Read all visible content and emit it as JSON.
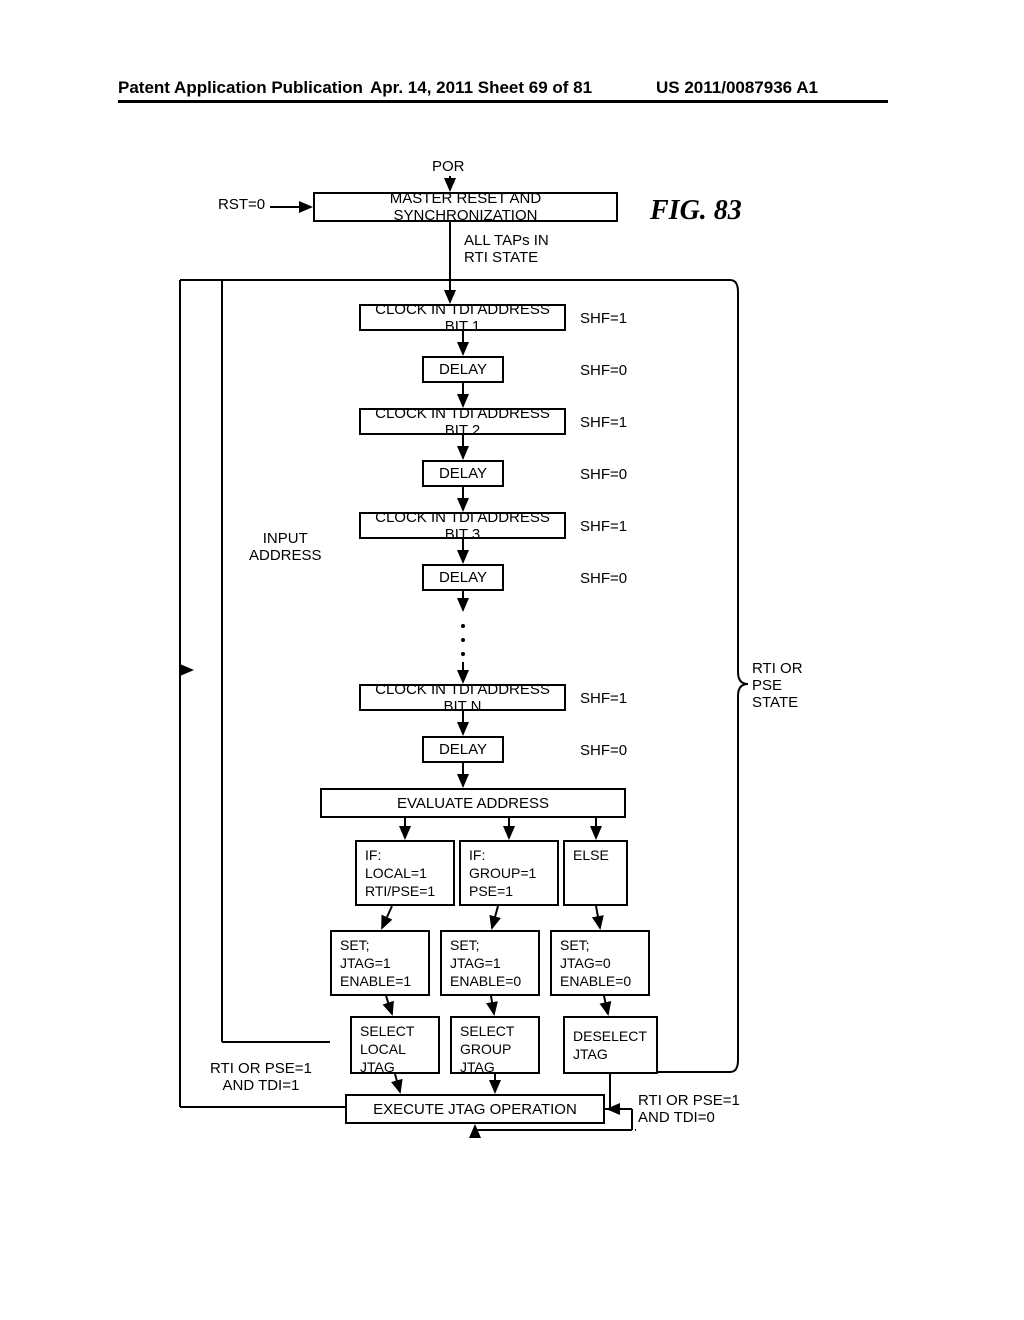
{
  "header": {
    "left": "Patent Application Publication",
    "mid": "Apr. 14, 2011  Sheet 69 of 81",
    "right": "US 2011/0087936 A1"
  },
  "figure_title": "FIG. 83",
  "por": "POR",
  "rst0": "RST=0",
  "master_reset": "MASTER RESET AND SYNCHRONIZATION",
  "all_taps": "ALL TAPs IN\nRTI STATE",
  "input_address": "INPUT\nADDRESS",
  "clock1": "CLOCK IN TDI ADDRESS BIT 1",
  "clock2": "CLOCK IN TDI ADDRESS BIT 2",
  "clock3": "CLOCK IN TDI ADDRESS BIT 3",
  "clockn": "CLOCK IN TDI ADDRESS BIT N",
  "delay": "DELAY",
  "shf1": "SHF=1",
  "shf0": "SHF=0",
  "evaluate": "EVALUATE ADDRESS",
  "if1": "IF:\nLOCAL=1\nRTI/PSE=1",
  "if2": "IF:\nGROUP=1\nPSE=1",
  "else": "ELSE",
  "set1": "SET;\nJTAG=1\nENABLE=1",
  "set2": "SET;\nJTAG=1\nENABLE=0",
  "set3": "SET;\nJTAG=0\nENABLE=0",
  "sel_local": "SELECT\nLOCAL\nJTAG",
  "sel_group": "SELECT\nGROUP\nJTAG",
  "deselect": "DESELECT\nJTAG",
  "exec": "EXECUTE JTAG OPERATION",
  "rti_pse_or": "RTI OR\nPSE\nSTATE",
  "rti_pse_tdi1": "RTI OR PSE=1\nAND TDI=1",
  "rti_pse_tdi0": "RTI OR PSE=1\nAND TDI=0",
  "chart_data": {
    "type": "flowchart",
    "title": "FIG. 83",
    "entry": "POR",
    "nodes": [
      {
        "id": "master_reset",
        "label": "MASTER RESET AND SYNCHRONIZATION",
        "cond_in": [
          "POR",
          "RST=0"
        ],
        "annotation_out": "ALL TAPs IN RTI STATE"
      },
      {
        "id": "bit1",
        "label": "CLOCK IN TDI ADDRESS BIT 1",
        "side": "SHF=1"
      },
      {
        "id": "delay1",
        "label": "DELAY",
        "side": "SHF=0"
      },
      {
        "id": "bit2",
        "label": "CLOCK IN TDI ADDRESS BIT 2",
        "side": "SHF=1"
      },
      {
        "id": "delay2",
        "label": "DELAY",
        "side": "SHF=0"
      },
      {
        "id": "bit3",
        "label": "CLOCK IN TDI ADDRESS BIT 3",
        "side": "SHF=1"
      },
      {
        "id": "delay3",
        "label": "DELAY",
        "side": "SHF=0"
      },
      {
        "id": "bitn",
        "label": "CLOCK IN TDI ADDRESS BIT N",
        "side": "SHF=1"
      },
      {
        "id": "delayn",
        "label": "DELAY",
        "side": "SHF=0"
      },
      {
        "id": "evaluate",
        "label": "EVALUATE ADDRESS"
      },
      {
        "id": "cond1",
        "label": "IF: LOCAL=1 RTI/PSE=1",
        "then": "set1"
      },
      {
        "id": "cond2",
        "label": "IF: GROUP=1 PSE=1",
        "then": "set2"
      },
      {
        "id": "cond3",
        "label": "ELSE",
        "then": "set3"
      },
      {
        "id": "set1",
        "label": "SET; JTAG=1 ENABLE=1",
        "annot": "SELECT LOCAL JTAG"
      },
      {
        "id": "set2",
        "label": "SET; JTAG=1 ENABLE=0",
        "annot": "SELECT GROUP JTAG"
      },
      {
        "id": "set3",
        "label": "SET; JTAG=0 ENABLE=0",
        "annot": "DESELECT JTAG"
      },
      {
        "id": "exec",
        "label": "EXECUTE JTAG OPERATION"
      }
    ],
    "loops": [
      {
        "from": "exec",
        "to": "bit1",
        "cond": "RTI OR PSE=1 AND TDI=1"
      },
      {
        "from": "exec",
        "to": "exec",
        "cond": "RTI OR PSE=1 AND TDI=0"
      }
    ],
    "region_label": "INPUT ADDRESS",
    "state_label": "RTI OR PSE STATE"
  }
}
